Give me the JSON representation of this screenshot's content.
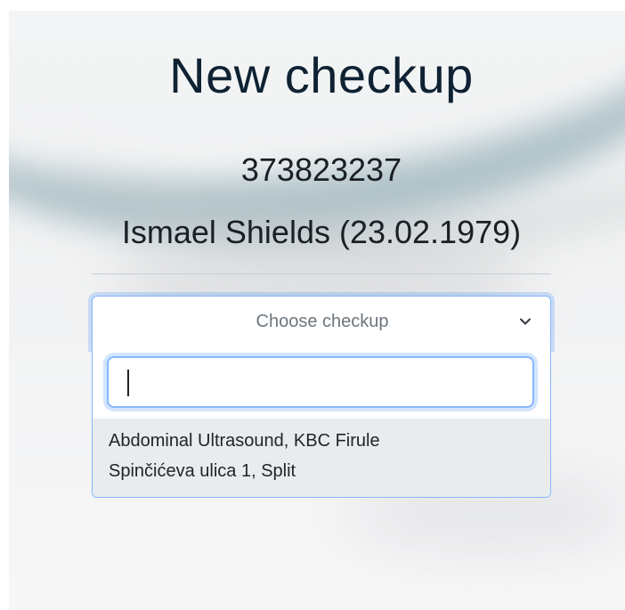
{
  "header": {
    "title": "New checkup"
  },
  "patient": {
    "id": "373823237",
    "name_dob": "Ismael Shields (23.02.1979)"
  },
  "checkup_select": {
    "placeholder": "Choose checkup",
    "search_value": "",
    "options": [
      {
        "line1": "Abdominal Ultrasound, KBC Firule",
        "line2": "Spinčićeva ulica 1, Split"
      }
    ]
  },
  "icons": {
    "dropdown": "chevron-down-icon"
  },
  "colors": {
    "title": "#0f2233",
    "focus_border": "#86b7fe",
    "option_highlight": "#e9ecef",
    "placeholder": "#6c757d"
  }
}
